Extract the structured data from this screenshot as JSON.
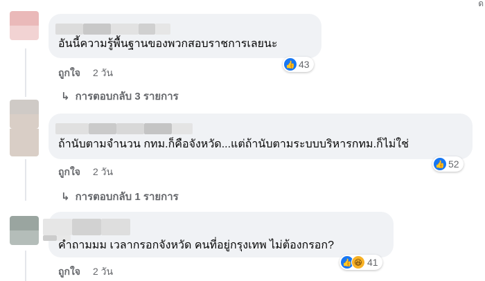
{
  "comments": [
    {
      "text": "อันนี้ความรู้พื้นฐานของพวกสอบราชการเลยนะ",
      "like_label": "ถูกใจ",
      "time": "2 วัน",
      "reaction_count": "43",
      "reactions": [
        "like-icon"
      ],
      "replies_label": "การตอบกลับ 3 รายการ",
      "avatar_colors": [
        "#eab9b9",
        "#f2d3d3"
      ],
      "name_colors": [
        "#dcdcdc",
        "#c8c8c8",
        "#e2e2e2",
        "#d0d0d0",
        "#e6e6e6"
      ]
    },
    {
      "text": "ถ้านับตามจำนวน กทม.ก็คือจังหวัด...แต่ถ้านับตามระบบบริหารกทม.ก็ไม่ใช่",
      "like_label": "ถูกใจ",
      "time": "2 วัน",
      "reaction_count": "52",
      "reactions": [
        "like-icon"
      ],
      "replies_label": "การตอบกลับ 1 รายการ",
      "avatar_colors": [
        "#cfcac6",
        "#d9cec6"
      ],
      "name_colors": [
        "#e0e0e0",
        "#cacaca",
        "#d8d8d8",
        "#c4c4c4",
        "#e4e4e4"
      ]
    },
    {
      "text": "คำถามมม เวลากรอกจังหวัด คนที่อยู่กรุงเทพ ไม่ต้องกรอก?",
      "like_label": "ถูกใจ",
      "time": "2 วัน",
      "reaction_count": "41",
      "reactions": [
        "like-icon",
        "haha-icon"
      ],
      "avatar_colors": [
        "#9aa5a0",
        "#b4bdb9"
      ],
      "name_colors": [
        "#e6e6e6",
        "#d2d2d2",
        "#dedede",
        "#cccccc",
        "#e8e8e8"
      ]
    }
  ],
  "icons": {
    "reply_arrow": "↳",
    "like": "👍",
    "haha": "😆"
  },
  "colors": {
    "bubble": "#f0f2f5",
    "secondary_text": "#65676b",
    "like_blue": "#1877f2"
  }
}
